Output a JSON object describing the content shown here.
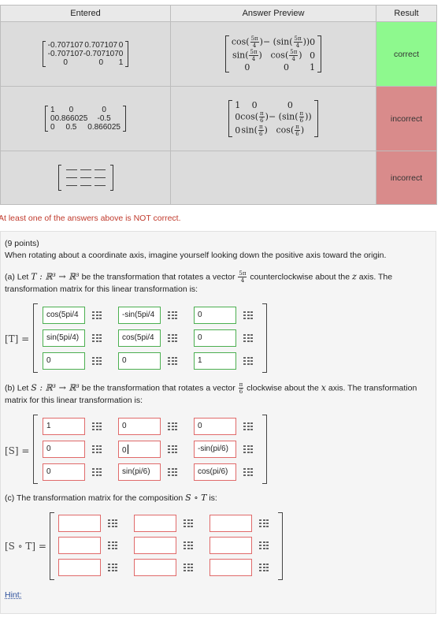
{
  "results_table": {
    "headers": [
      "Entered",
      "Answer Preview",
      "Result"
    ],
    "rows": [
      {
        "entered": [
          [
            "-0.707107",
            "0.707107",
            "0"
          ],
          [
            "-0.707107",
            "-0.707107",
            "0"
          ],
          [
            "0",
            "0",
            "1"
          ]
        ],
        "preview": [
          [
            "cos(5π/4)",
            "−(sin(5π/4))",
            "0"
          ],
          [
            "sin(5π/4)",
            "cos(5π/4)",
            "0"
          ],
          [
            "0",
            "0",
            "1"
          ]
        ],
        "result": "correct",
        "status": "correct"
      },
      {
        "entered": [
          [
            "1",
            "0",
            "0"
          ],
          [
            "0",
            "0.866025",
            "-0.5"
          ],
          [
            "0",
            "0.5",
            "0.866025"
          ]
        ],
        "preview": [
          [
            "1",
            "0",
            "0"
          ],
          [
            "0",
            "cos(π/6)",
            "−(sin(π/6))"
          ],
          [
            "0",
            "sin(π/6)",
            "cos(π/6)"
          ]
        ],
        "result": "incorrect",
        "status": "incorrect"
      },
      {
        "entered": [],
        "preview": [],
        "result": "incorrect",
        "status": "incorrect"
      }
    ]
  },
  "warning": "At least one of the answers above is NOT correct.",
  "problem": {
    "points": "(9 points)",
    "intro": "When rotating about a coordinate axis, imagine yourself looking down the positive axis toward the origin.",
    "part_a": {
      "text_1": "(a) Let",
      "map": "T : ℝ³ → ℝ³",
      "text_2": "be the transformation that rotates a vector",
      "angle_num": "5π",
      "angle_den": "4",
      "text_3": "counterclockwise about the",
      "axis": "z",
      "text_4": "axis. The",
      "text_5": "transformation matrix for this linear transformation is:",
      "lhs": "[T] =",
      "cells": [
        {
          "value": "cos(5pi/4",
          "state": "green"
        },
        {
          "value": "-sin(5pi/4",
          "state": "green"
        },
        {
          "value": "0",
          "state": "green"
        },
        {
          "value": "sin(5pi/4)",
          "state": "green"
        },
        {
          "value": "cos(5pi/4",
          "state": "green"
        },
        {
          "value": "0",
          "state": "green"
        },
        {
          "value": "0",
          "state": "green"
        },
        {
          "value": "0",
          "state": "green"
        },
        {
          "value": "1",
          "state": "green"
        }
      ]
    },
    "part_b": {
      "text_1": "(b) Let",
      "map": "S : ℝ³ → ℝ³",
      "text_2": "be the transformation that rotates a vector",
      "angle_num": "π",
      "angle_den": "6",
      "text_3": "clockwise about the",
      "axis": "x",
      "text_4": "axis. The transformation",
      "text_5": "matrix for this linear transformation is:",
      "lhs": "[S] =",
      "cells": [
        {
          "value": "1",
          "state": "red"
        },
        {
          "value": "0",
          "state": "red"
        },
        {
          "value": "0",
          "state": "red"
        },
        {
          "value": "0",
          "state": "red"
        },
        {
          "value": "0",
          "state": "red",
          "focused": true
        },
        {
          "value": "-sin(pi/6)",
          "state": "red"
        },
        {
          "value": "0",
          "state": "red"
        },
        {
          "value": "sin(pi/6)",
          "state": "red"
        },
        {
          "value": "cos(pi/6)",
          "state": "red"
        }
      ]
    },
    "part_c": {
      "text_1": "(c) The transformation matrix for the composition",
      "composition": "S ∘ T",
      "text_2": "is:",
      "lhs": "[S ∘ T] =",
      "cells": [
        {
          "value": "",
          "state": "red"
        },
        {
          "value": "",
          "state": "red"
        },
        {
          "value": "",
          "state": "red"
        },
        {
          "value": "",
          "state": "red"
        },
        {
          "value": "",
          "state": "red"
        },
        {
          "value": "",
          "state": "red"
        },
        {
          "value": "",
          "state": "red"
        },
        {
          "value": "",
          "state": "red"
        },
        {
          "value": "",
          "state": "red"
        }
      ]
    },
    "hint": "Hint:"
  },
  "colors": {
    "correct": "#8ef98e",
    "incorrect": "#d98b8b",
    "field_ok_border": "#4caf50",
    "field_bad_border": "#e06a6a",
    "warning": "#c0392b",
    "link": "#2a4d9b"
  },
  "icons": {
    "field_icon": "matrix-grid-icon"
  }
}
